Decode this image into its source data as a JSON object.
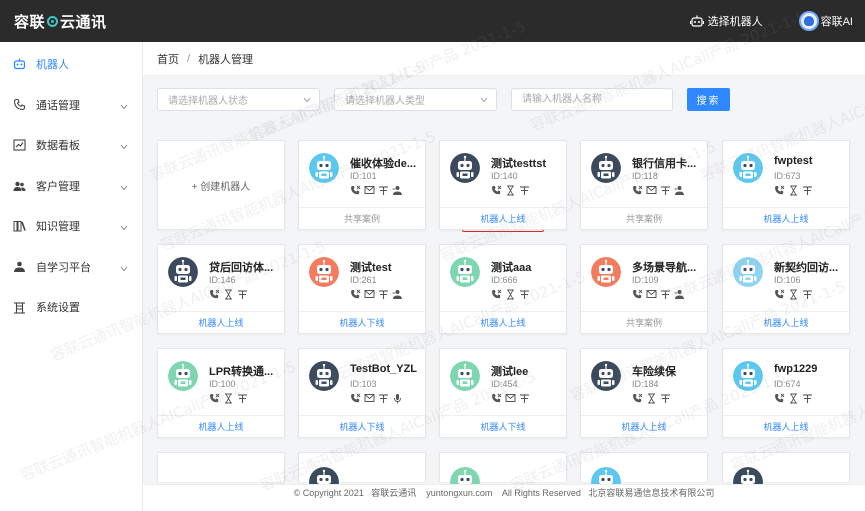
{
  "header": {
    "logo_left": "容联",
    "logo_right": "云通讯",
    "select_robot": "选择机器人",
    "user_name": "容联AI"
  },
  "sidebar": {
    "items": [
      {
        "label": "机器人",
        "icon": "robot-icon",
        "active": true,
        "has_chevron": false
      },
      {
        "label": "通话管理",
        "icon": "phone-icon",
        "active": false,
        "has_chevron": true
      },
      {
        "label": "数据看板",
        "icon": "chart-icon",
        "active": false,
        "has_chevron": true
      },
      {
        "label": "客户管理",
        "icon": "users-icon",
        "active": false,
        "has_chevron": true
      },
      {
        "label": "知识管理",
        "icon": "book-icon",
        "active": false,
        "has_chevron": true
      },
      {
        "label": "自学习平台",
        "icon": "learn-icon",
        "active": false,
        "has_chevron": true
      },
      {
        "label": "系统设置",
        "icon": "settings-icon",
        "active": false,
        "has_chevron": false
      }
    ]
  },
  "breadcrumb": {
    "home": "首页",
    "separator": "/",
    "current": "机器人管理"
  },
  "filters": {
    "status_placeholder": "请选择机器人状态",
    "type_placeholder": "请选择机器人类型",
    "name_placeholder": "请输入机器人名称",
    "search_label": "搜索"
  },
  "create_label": "+ 创建机器人",
  "colors": {
    "accent": "#2f88ff",
    "highlight": "#e5242b",
    "header_bg": "#2b2b2b"
  },
  "robots": [
    {
      "name": "催收体验de...",
      "id": "ID:101",
      "caps": [
        "phone",
        "chat",
        "text",
        "flow"
      ],
      "action": "共享案例",
      "status": "shared",
      "avatar_bg": "#5cc8ef",
      "avatar_style": "cyan-bot"
    },
    {
      "name": "测试testtst",
      "id": "ID:140",
      "caps": [
        "phone",
        "hourglass",
        "text"
      ],
      "action": "机器人上线",
      "status": "online",
      "avatar_bg": "#3b4a5c",
      "avatar_style": "dark-bot"
    },
    {
      "name": "银行信用卡...",
      "id": "ID:118",
      "caps": [
        "phone",
        "chat",
        "text",
        "flow"
      ],
      "action": "共享案例",
      "status": "shared",
      "avatar_bg": "#3b4a5c",
      "avatar_style": "dark-bot"
    },
    {
      "name": "fwptest",
      "id": "ID:673",
      "caps": [
        "phone",
        "hourglass",
        "text"
      ],
      "action": "机器人上线",
      "status": "online",
      "avatar_bg": "#5cc8ef",
      "avatar_style": "cyan-bot"
    },
    {
      "name": "贷后回访体...",
      "id": "ID:146",
      "caps": [
        "phone",
        "hourglass",
        "text"
      ],
      "action": "机器人上线",
      "status": "online",
      "avatar_bg": "#3b4a5c",
      "avatar_style": "dark-bot"
    },
    {
      "name": "测试test",
      "id": "ID:261",
      "caps": [
        "phone",
        "chat",
        "text",
        "flow"
      ],
      "action": "机器人下线",
      "status": "offline",
      "avatar_bg": "#f47b5e",
      "avatar_style": "orange-bot"
    },
    {
      "name": "测试aaa",
      "id": "ID:666",
      "caps": [
        "phone",
        "hourglass",
        "text"
      ],
      "action": "机器人上线",
      "status": "online",
      "avatar_bg": "#7ed7b0",
      "avatar_style": "green-bot"
    },
    {
      "name": "多场景导航...",
      "id": "ID:109",
      "caps": [
        "phone",
        "chat",
        "text",
        "flow"
      ],
      "action": "共享案例",
      "status": "shared",
      "avatar_bg": "#f47b5e",
      "avatar_style": "orange-bot"
    },
    {
      "name": "新契约回访...",
      "id": "ID:106",
      "caps": [
        "phone",
        "hourglass",
        "text"
      ],
      "action": "机器人上线",
      "status": "online",
      "avatar_bg": "#8fd3f4",
      "avatar_style": "light-bot"
    },
    {
      "name": "LPR转换通...",
      "id": "ID:100",
      "caps": [
        "phone",
        "hourglass",
        "text"
      ],
      "action": "机器人上线",
      "status": "online",
      "avatar_bg": "#7ed7b0",
      "avatar_style": "green-bot"
    },
    {
      "name": "TestBot_YZL",
      "id": "ID:103",
      "caps": [
        "phone",
        "chat",
        "text",
        "mic"
      ],
      "action": "机器人下线",
      "status": "offline",
      "avatar_bg": "#3b4a5c",
      "avatar_style": "dark-bot"
    },
    {
      "name": "测试lee",
      "id": "ID:454",
      "caps": [
        "phone",
        "chat",
        "text"
      ],
      "action": "机器人下线",
      "status": "offline",
      "avatar_bg": "#7ed7b0",
      "avatar_style": "green-bot"
    },
    {
      "name": "车险续保",
      "id": "ID:184",
      "caps": [
        "phone",
        "hourglass",
        "text"
      ],
      "action": "机器人上线",
      "status": "online",
      "avatar_bg": "#3b4a5c",
      "avatar_style": "dark-bot"
    },
    {
      "name": "fwp1229",
      "id": "ID:674",
      "caps": [
        "phone",
        "hourglass",
        "text"
      ],
      "action": "机器人上线",
      "status": "online",
      "avatar_bg": "#5cc8ef",
      "avatar_style": "cyan-bot"
    }
  ],
  "partial_row_avatar_colors": [
    "#3b4a5c",
    "#3b4a5c",
    "#7ed7b0",
    "#5cc8ef",
    "#3b4a5c"
  ],
  "footer": {
    "copyright": "© Copyright 2021",
    "company": "容联云通讯",
    "domain": "yuntongxun.com",
    "rights": "All Rights Reserved",
    "org": "北京容联易通信息技术有限公司"
  },
  "watermark": "容联云通讯智能机器人AICall产品 2021-1-5"
}
